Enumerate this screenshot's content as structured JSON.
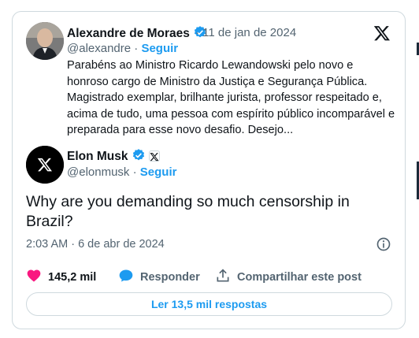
{
  "quoted": {
    "name": "Alexandre de Moraes",
    "date": "· 11 de jan de 2024",
    "handle": "@alexandre",
    "separator": " · ",
    "follow": "Seguir",
    "text": "Parabéns ao Ministro Ricardo Lewandowski pelo novo e honroso cargo de Ministro da Justiça e Segurança Pública. Magistrado exemplar, brilhante jurista, professor respeitado e, acima de tudo, uma pessoa com espírito público incomparável e preparada para esse novo desafio. Desejo..."
  },
  "tweet": {
    "name": "Elon Musk",
    "handle": "@elonmusk",
    "separator": " · ",
    "follow": "Seguir",
    "text": "Why are you demanding so much censorship in Brazil?",
    "time": "2:03 AM · 6 de abr de 2024"
  },
  "actions": {
    "likes": "145,2 mil",
    "reply": "Responder",
    "share": "Compartilhar este post"
  },
  "read_replies": "Ler 13,5 mil respostas",
  "colors": {
    "accent": "#1d9bf0",
    "like": "#f91880",
    "muted": "#536471"
  }
}
